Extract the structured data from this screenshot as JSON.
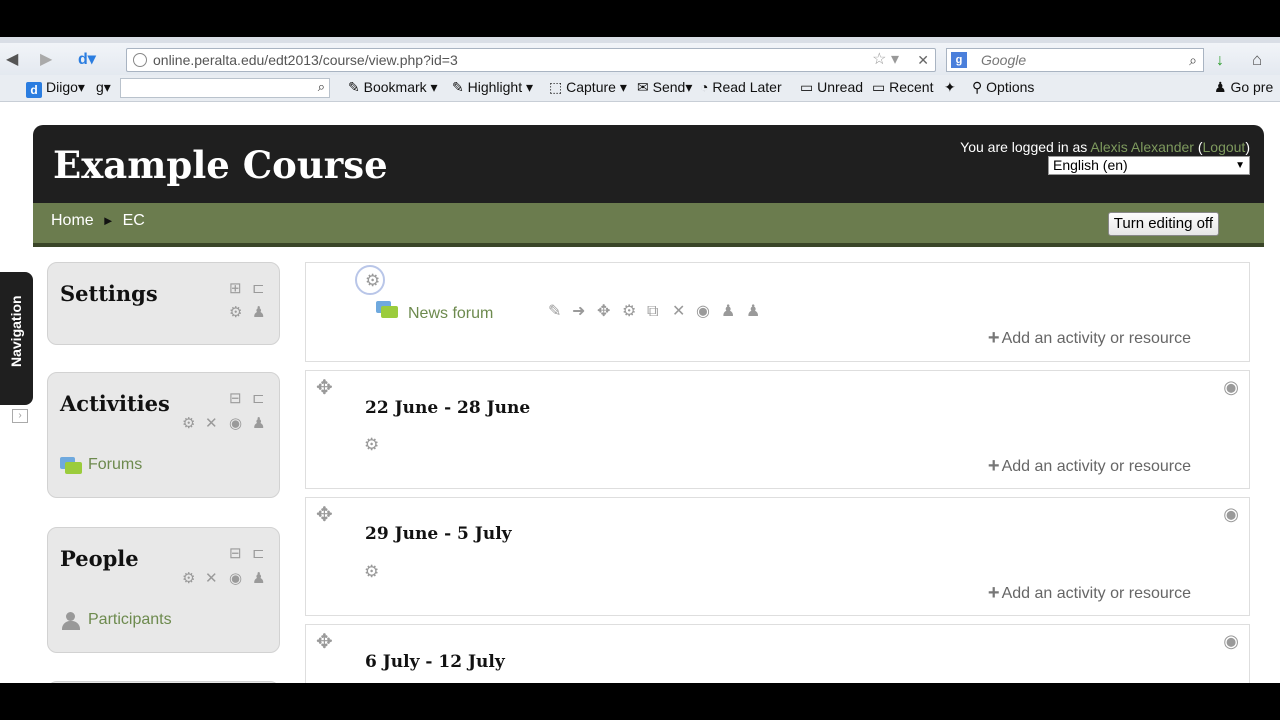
{
  "browser": {
    "url": "online.peralta.edu/edt2013/course/view.php?id=3",
    "search_placeholder": "Google",
    "toolbar": {
      "diigo": "Diigo",
      "bookmark": "Bookmark",
      "highlight": "Highlight",
      "capture": "Capture",
      "send": "Send",
      "read_later": "Read Later",
      "unread": "Unread",
      "recent": "Recent",
      "options": "Options",
      "go_pre": "Go pre"
    }
  },
  "header": {
    "course_title": "Example Course",
    "logged_in_prefix": "You are logged in as",
    "user_name": "Alexis Alexander",
    "logout": "Logout",
    "language": "English (en)"
  },
  "breadcrumb": {
    "home": "Home",
    "separator": "►",
    "current": "EC"
  },
  "editing_button": "Turn editing off",
  "nav_tab": "Navigation",
  "blocks": {
    "settings": {
      "title": "Settings"
    },
    "activities": {
      "title": "Activities",
      "link": "Forums"
    },
    "people": {
      "title": "People",
      "link": "Participants"
    }
  },
  "sections": {
    "general": {
      "activity": "News forum",
      "add": "Add an activity or resource"
    },
    "week1": {
      "title": "22 June - 28 June",
      "add": "Add an activity or resource"
    },
    "week2": {
      "title": "29 June - 5 July",
      "add": "Add an activity or resource"
    },
    "week3": {
      "title": "6 July - 12 July"
    }
  },
  "colors": {
    "header_bg": "#1f1f1f",
    "nav_strip": "#6b7c4e",
    "link_green": "#6d8a4e"
  }
}
